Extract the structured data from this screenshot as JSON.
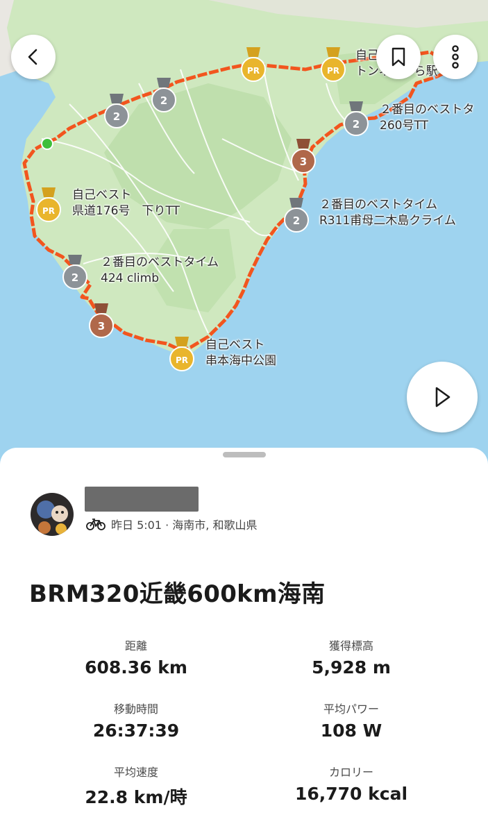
{
  "map": {
    "labels": [
      {
        "text": "自己ベスト\nトンネルから駅",
        "id": "segment-pr-top"
      },
      {
        "text": "２番目のベストタ\n260号TT",
        "id": "segment-2nd-260"
      },
      {
        "text": "自己ベスト\n県道176号　下りTT",
        "id": "segment-pr-176"
      },
      {
        "text": "２番目のベストタイム\nR311甫母二木島クライム",
        "id": "segment-2nd-r311"
      },
      {
        "text": "２番目のベストタイム\n424 climb",
        "id": "segment-2nd-424"
      },
      {
        "text": "自己ベスト\n串本海中公園",
        "id": "segment-pr-kushimoto"
      }
    ],
    "medals": {
      "pr": "PR",
      "second": "2",
      "third": "3"
    },
    "colors": {
      "route": "#f2551e",
      "land": "#cfe8bf",
      "sea": "#9ed3ef",
      "pr": "#e9b52c",
      "silver": "#8d9398",
      "bronze": "#b0684a",
      "start": "#3fbf3b"
    }
  },
  "toolbar": {
    "back_icon": "chevron-left-icon",
    "bookmark_icon": "bookmark-icon",
    "more_icon": "more-vertical-icon",
    "play_icon": "play-icon"
  },
  "activity": {
    "meta": "昨日 5:01 · 海南市, 和歌山県",
    "sport_icon": "bike-icon",
    "title": "BRM320近畿600km海南"
  },
  "stats": [
    {
      "label": "距離",
      "value": "608.36 km"
    },
    {
      "label": "獲得標高",
      "value": "5,928 m"
    },
    {
      "label": "移動時間",
      "value": "26:37:39"
    },
    {
      "label": "平均パワー",
      "value": "108 W"
    },
    {
      "label": "平均速度",
      "value": "22.8 km/時"
    },
    {
      "label": "カロリー",
      "value": "16,770 kcal"
    }
  ]
}
